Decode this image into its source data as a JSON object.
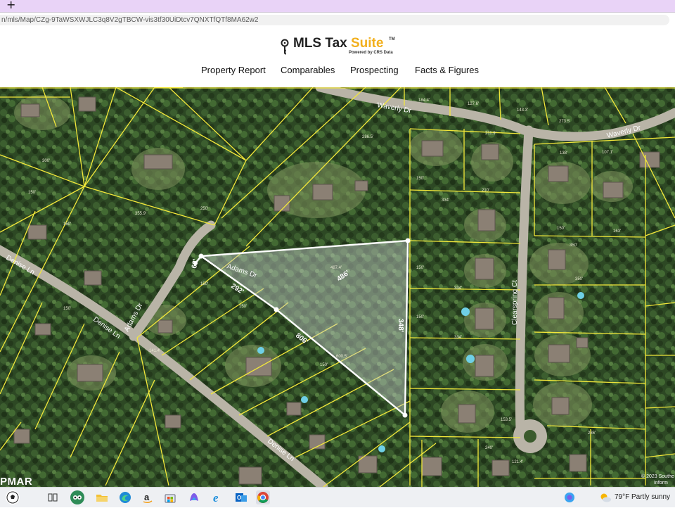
{
  "browser": {
    "new_tab_label": "+",
    "url": "n/mls/Map/CZg-9TaWSXWJLC3q8V2gTBCW-vis3tf30UiDtcv7QNXTfQTf8MA62w2"
  },
  "header": {
    "logo": {
      "brand": "MLS Tax ",
      "accent": "Suite",
      "tm": "TM",
      "powered": "Powered by CRS Data"
    },
    "nav": [
      {
        "label": "Property Report"
      },
      {
        "label": "Comparables"
      },
      {
        "label": "Prospecting"
      },
      {
        "label": "Facts & Figures"
      }
    ]
  },
  "map": {
    "streets": {
      "waverly_1": "Waverly Dr",
      "waverly_2": "Waverly Dr",
      "adams_1": "Adams Dr",
      "adams_2": "Adams Dr",
      "denise_1": "Denise Ln",
      "denise_2": "Denise Ln",
      "denise_3": "Denise Ln",
      "clearspring": "Clearspring Ct"
    },
    "parcel_dims": {
      "side_a": "486'",
      "side_b": "806'",
      "side_c": "348'",
      "side_d": "292'",
      "side_e": "63'"
    },
    "lot_labels": [
      "184.4'",
      "127.6'",
      "143.3'",
      "273.5'",
      "211.9'",
      "150'",
      "210'",
      "334'",
      "138'",
      "107.1'",
      "150'",
      "163'",
      "350'",
      "350'",
      "150'",
      "334'",
      "150'",
      "334'",
      "286'",
      "240'",
      "121.4'",
      "150'",
      "300'",
      "150'",
      "150'",
      "150'",
      "355.9'",
      "250'",
      "150'",
      "141.4'",
      "150'",
      "600.5'",
      "487.4'",
      "286.5'",
      "153.5'"
    ],
    "copyright": "© 2023 Southe",
    "copyright_2": "Inform",
    "watermark": "PMAR",
    "colors": {
      "parcel_line": "#f3e83a",
      "subject_fill": "#c8d0cf",
      "subject_stroke": "#ffffff",
      "road": "#b9b4a7"
    }
  },
  "taskbar": {
    "weather_temp": "79°F",
    "weather_desc": "Partly sunny",
    "apps": [
      "soccer-ball-icon",
      "task-view-icon",
      "tripadvisor-icon",
      "file-explorer-icon",
      "edge-icon",
      "amazon-icon",
      "store-icon",
      "copilot-icon",
      "ie-icon",
      "outlook-icon",
      "chrome-icon"
    ]
  }
}
